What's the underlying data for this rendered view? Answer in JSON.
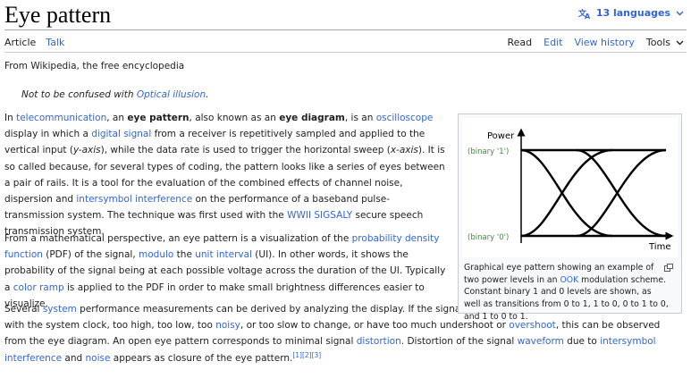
{
  "page": {
    "title": "Eye pattern",
    "languages": "13 languages",
    "tabs_left": [
      "Article",
      "Talk"
    ],
    "tabs_right": [
      "Read",
      "Edit",
      "View history"
    ],
    "tools": "Tools",
    "from": "From Wikipedia, the free encyclopedia",
    "hatnote": {
      "prefix": "Not to be confused with ",
      "link": "Optical illusion",
      "suffix": "."
    }
  },
  "p1": {
    "t0": "In ",
    "l0": "telecommunication",
    "t1": ", an ",
    "b0": "eye pattern",
    "t2": ", also known as an ",
    "b1": "eye diagram",
    "t3": ", is an ",
    "l1": "oscilloscope",
    "t4": " display in which a ",
    "l2": "digital signal",
    "t5": " from a receiver is repetitively sampled and applied to the vertical input (",
    "i0": "y-axis",
    "t6": "), while the data rate is used to trigger the horizontal sweep (",
    "i1": "x-axis",
    "t7": "). It is so called because, for several types of coding, the pattern looks like a series of eyes between a pair of rails. It is a tool for the evaluation of the combined effects of channel noise, dispersion and ",
    "l3": "intersymbol interference",
    "t8": " on the performance of a baseband pulse-transmission system. The technique was first used with the ",
    "l4": "WWII SIGSALY",
    "t9": " secure speech transmission system."
  },
  "p2": {
    "t0": "From a mathematical perspective, an eye pattern is a visualization of the ",
    "l0": "probability density function",
    "t1": " (PDF) of the signal, ",
    "l1": "modulo",
    "t2": " the ",
    "l2": "unit interval",
    "t3": " (UI). In other words, it shows the probability of the signal being at each possible voltage across the duration of the UI. Typically a ",
    "l3": "color ramp",
    "t4": " is applied to the PDF in order to make small brightness differences easier to visualize."
  },
  "p3": {
    "t0": "Several ",
    "l0": "system",
    "t1": " performance measurements can be derived by analyzing the display. If the signals are too long, too short, poorly synchronized with the system clock, too high, too low, too ",
    "l1": "noisy",
    "t2": ", or too slow to change, or have too much undershoot or ",
    "l2": "overshoot",
    "t3": ", this can be observed from the eye diagram. An open eye pattern corresponds to minimal signal ",
    "l3": "distortion",
    "t4": ". Distortion of the signal ",
    "l4": "waveform",
    "t5": " due to ",
    "l5": "intersymbol interference",
    "t6": " and ",
    "l6": "noise",
    "t7": " appears as closure of the eye pattern.",
    "ref1": "[1]",
    "ref2": "[2]",
    "ref3": "[3]"
  },
  "figure": {
    "power_label": "Power",
    "binary1_label": "(binary '1')",
    "binary0_label": "(binary '0')",
    "time_label": "Time",
    "caption_t0": "Graphical eye pattern showing an example of two power levels in an ",
    "caption_link": "OOK",
    "caption_t1": " modulation scheme. Constant binary 1 and 0 levels are shown, as well as transitions from 0 to 1, 1 to 0, 0 to 1 to 0, and 1 to 0 to 1."
  },
  "colors": {
    "link": "#3366cc",
    "label_green": "#448844",
    "text": "#202122"
  }
}
